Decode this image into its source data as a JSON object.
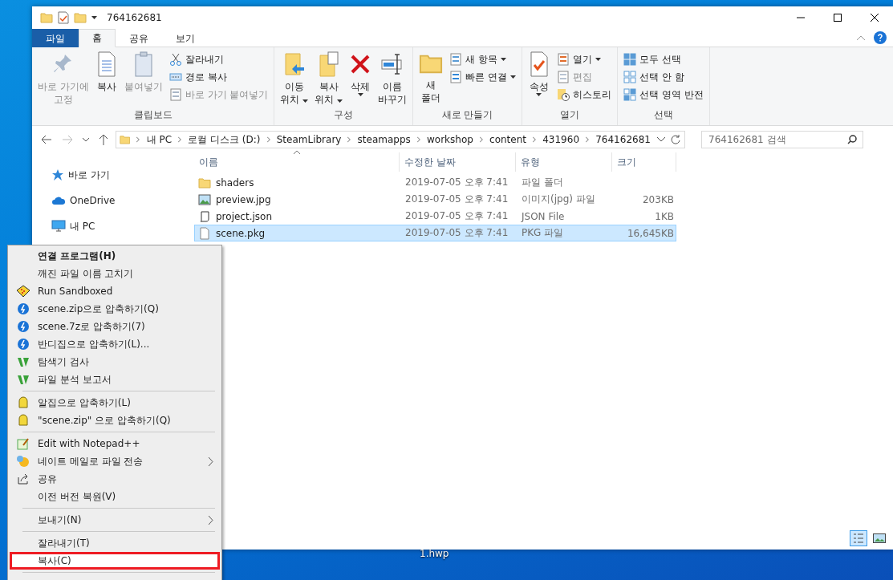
{
  "desktop": {
    "icon_label": "1.hwp"
  },
  "window": {
    "title": "764162681"
  },
  "ribbon": {
    "tabs": [
      {
        "label": "파일",
        "kind": "file",
        "selected": false
      },
      {
        "label": "홈",
        "kind": "tab",
        "selected": true
      },
      {
        "label": "공유",
        "kind": "tab",
        "selected": false
      },
      {
        "label": "보기",
        "kind": "tab",
        "selected": false
      }
    ],
    "groups": [
      {
        "label": "클립보드",
        "large": [
          {
            "label": "바로 가기에\n고정",
            "disabled": true,
            "dropdown": false
          },
          {
            "label": "복사",
            "disabled": false,
            "dropdown": false
          },
          {
            "label": "붙여넣기",
            "disabled": true,
            "dropdown": false
          }
        ],
        "small": [
          {
            "label": "잘라내기",
            "disabled": false,
            "dropdown": false
          },
          {
            "label": "경로 복사",
            "disabled": false,
            "dropdown": false
          },
          {
            "label": "바로 가기 붙여넣기",
            "disabled": true,
            "dropdown": false
          }
        ]
      },
      {
        "label": "구성",
        "large": [
          {
            "label": "이동\n위치",
            "disabled": false,
            "dropdown": true
          },
          {
            "label": "복사\n위치",
            "disabled": false,
            "dropdown": true
          },
          {
            "label": "삭제",
            "disabled": false,
            "dropdown": true
          },
          {
            "label": "이름\n바꾸기",
            "disabled": false,
            "dropdown": false
          }
        ]
      },
      {
        "label": "새로 만들기",
        "large": [
          {
            "label": "새\n폴더",
            "disabled": false,
            "dropdown": false
          }
        ],
        "small": [
          {
            "label": "새 항목",
            "disabled": false,
            "dropdown": true
          },
          {
            "label": "빠른 연결",
            "disabled": false,
            "dropdown": true
          }
        ]
      },
      {
        "label": "열기",
        "large": [
          {
            "label": "속성",
            "disabled": false,
            "dropdown": true
          }
        ],
        "small": [
          {
            "label": "열기",
            "disabled": false,
            "dropdown": true
          },
          {
            "label": "편집",
            "disabled": true,
            "dropdown": false
          },
          {
            "label": "히스토리",
            "disabled": false,
            "dropdown": false
          }
        ]
      },
      {
        "label": "선택",
        "small": [
          {
            "label": "모두 선택",
            "disabled": false,
            "dropdown": false
          },
          {
            "label": "선택 안 함",
            "disabled": false,
            "dropdown": false
          },
          {
            "label": "선택 영역 반전",
            "disabled": false,
            "dropdown": false
          }
        ]
      }
    ]
  },
  "address": {
    "crumbs": [
      "내 PC",
      "로컬 디스크 (D:)",
      "SteamLibrary",
      "steamapps",
      "workshop",
      "content",
      "431960",
      "764162681"
    ],
    "search_placeholder": "764162681 검색"
  },
  "nav": {
    "items": [
      {
        "label": "바로 가기"
      },
      {
        "label": "OneDrive"
      },
      {
        "label": "내 PC"
      }
    ]
  },
  "table": {
    "columns": [
      "이름",
      "수정한 날짜",
      "유형",
      "크기"
    ],
    "rows": [
      {
        "name": "shaders",
        "date": "2019-07-05 오후 7:41",
        "type": "파일 폴더",
        "size": "",
        "kind": "folder",
        "selected": false
      },
      {
        "name": "preview.jpg",
        "date": "2019-07-05 오후 7:41",
        "type": "이미지(jpg) 파일",
        "size": "203KB",
        "kind": "image",
        "selected": false
      },
      {
        "name": "project.json",
        "date": "2019-07-05 오후 7:41",
        "type": "JSON File",
        "size": "1KB",
        "kind": "script",
        "selected": false
      },
      {
        "name": "scene.pkg",
        "date": "2019-07-05 오후 7:41",
        "type": "PKG 파일",
        "size": "16,645KB",
        "kind": "file",
        "selected": true
      }
    ]
  },
  "view_buttons": [
    {
      "kind": "details",
      "selected": true
    },
    {
      "kind": "large",
      "selected": false
    }
  ],
  "context_menu": {
    "items": [
      {
        "kind": "item",
        "label": "연결 프로그램(H)",
        "bold": true,
        "submenu": false,
        "highlighted": false,
        "boxed": false
      },
      {
        "kind": "item",
        "label": "깨진 파일 이름 고치기",
        "bold": false,
        "submenu": false,
        "highlighted": false,
        "boxed": false
      },
      {
        "kind": "item",
        "label": "Run Sandboxed",
        "bold": false,
        "submenu": false,
        "highlighted": false,
        "boxed": false
      },
      {
        "kind": "item",
        "label": "scene.zip으로 압축하기(Q)",
        "bold": false,
        "submenu": false,
        "highlighted": false,
        "boxed": false
      },
      {
        "kind": "item",
        "label": "scene.7z로 압축하기(7)",
        "bold": false,
        "submenu": false,
        "highlighted": false,
        "boxed": false
      },
      {
        "kind": "item",
        "label": "반디집으로 압축하기(L)...",
        "bold": false,
        "submenu": false,
        "highlighted": false,
        "boxed": false
      },
      {
        "kind": "item",
        "label": "탐색기 검사",
        "bold": false,
        "submenu": false,
        "highlighted": false,
        "boxed": false
      },
      {
        "kind": "item",
        "label": "파일 분석 보고서",
        "bold": false,
        "submenu": false,
        "highlighted": false,
        "boxed": false
      },
      {
        "kind": "separator"
      },
      {
        "kind": "item",
        "label": "알집으로 압축하기(L)",
        "bold": false,
        "submenu": false,
        "highlighted": false,
        "boxed": false
      },
      {
        "kind": "item",
        "label": "\"scene.zip\" 으로 압축하기(Q)",
        "bold": false,
        "submenu": false,
        "highlighted": false,
        "boxed": false
      },
      {
        "kind": "separator"
      },
      {
        "kind": "item",
        "label": "Edit with Notepad++",
        "bold": false,
        "submenu": false,
        "highlighted": false,
        "boxed": false
      },
      {
        "kind": "item",
        "label": "네이트 메일로 파일 전송",
        "bold": false,
        "submenu": true,
        "highlighted": false,
        "boxed": false
      },
      {
        "kind": "item",
        "label": "공유",
        "bold": false,
        "submenu": false,
        "highlighted": false,
        "boxed": false
      },
      {
        "kind": "item",
        "label": "이전 버전 복원(V)",
        "bold": false,
        "submenu": false,
        "highlighted": false,
        "boxed": false
      },
      {
        "kind": "separator"
      },
      {
        "kind": "item",
        "label": "보내기(N)",
        "bold": false,
        "submenu": true,
        "highlighted": false,
        "boxed": false
      },
      {
        "kind": "separator"
      },
      {
        "kind": "item",
        "label": "잘라내기(T)",
        "bold": false,
        "submenu": false,
        "highlighted": false,
        "boxed": false
      },
      {
        "kind": "item",
        "label": "복사(C)",
        "bold": false,
        "submenu": false,
        "highlighted": true,
        "boxed": true
      },
      {
        "kind": "separator"
      }
    ]
  }
}
